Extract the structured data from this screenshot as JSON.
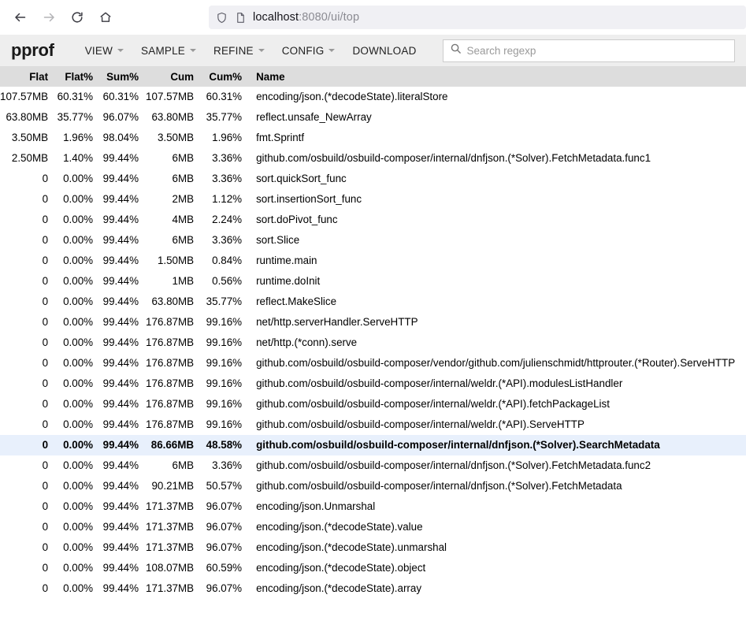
{
  "browser": {
    "back_label": "Back",
    "forward_label": "Forward",
    "reload_label": "Reload",
    "home_label": "Home",
    "url_host": "localhost",
    "url_path": ":8080/ui/top",
    "shield_icon": "shield-icon",
    "page_icon": "page-icon"
  },
  "app": {
    "logo": "pprof",
    "menu": [
      {
        "label": "VIEW",
        "has_caret": true
      },
      {
        "label": "SAMPLE",
        "has_caret": true
      },
      {
        "label": "REFINE",
        "has_caret": true
      },
      {
        "label": "CONFIG",
        "has_caret": true
      },
      {
        "label": "DOWNLOAD",
        "has_caret": false
      }
    ],
    "search": {
      "placeholder": "Search regexp",
      "value": "",
      "icon": "search-icon"
    }
  },
  "table": {
    "columns": [
      "Flat",
      "Flat%",
      "Sum%",
      "Cum",
      "Cum%",
      "Name"
    ],
    "rows": [
      {
        "flat": "107.57MB",
        "flatp": "60.31%",
        "sump": "60.31%",
        "cum": "107.57MB",
        "cump": "60.31%",
        "name": "encoding/json.(*decodeState).literalStore",
        "highlight": false
      },
      {
        "flat": "63.80MB",
        "flatp": "35.77%",
        "sump": "96.07%",
        "cum": "63.80MB",
        "cump": "35.77%",
        "name": "reflect.unsafe_NewArray",
        "highlight": false
      },
      {
        "flat": "3.50MB",
        "flatp": "1.96%",
        "sump": "98.04%",
        "cum": "3.50MB",
        "cump": "1.96%",
        "name": "fmt.Sprintf",
        "highlight": false
      },
      {
        "flat": "2.50MB",
        "flatp": "1.40%",
        "sump": "99.44%",
        "cum": "6MB",
        "cump": "3.36%",
        "name": "github.com/osbuild/osbuild-composer/internal/dnfjson.(*Solver).FetchMetadata.func1",
        "highlight": false
      },
      {
        "flat": "0",
        "flatp": "0.00%",
        "sump": "99.44%",
        "cum": "6MB",
        "cump": "3.36%",
        "name": "sort.quickSort_func",
        "highlight": false
      },
      {
        "flat": "0",
        "flatp": "0.00%",
        "sump": "99.44%",
        "cum": "2MB",
        "cump": "1.12%",
        "name": "sort.insertionSort_func",
        "highlight": false
      },
      {
        "flat": "0",
        "flatp": "0.00%",
        "sump": "99.44%",
        "cum": "4MB",
        "cump": "2.24%",
        "name": "sort.doPivot_func",
        "highlight": false
      },
      {
        "flat": "0",
        "flatp": "0.00%",
        "sump": "99.44%",
        "cum": "6MB",
        "cump": "3.36%",
        "name": "sort.Slice",
        "highlight": false
      },
      {
        "flat": "0",
        "flatp": "0.00%",
        "sump": "99.44%",
        "cum": "1.50MB",
        "cump": "0.84%",
        "name": "runtime.main",
        "highlight": false
      },
      {
        "flat": "0",
        "flatp": "0.00%",
        "sump": "99.44%",
        "cum": "1MB",
        "cump": "0.56%",
        "name": "runtime.doInit",
        "highlight": false
      },
      {
        "flat": "0",
        "flatp": "0.00%",
        "sump": "99.44%",
        "cum": "63.80MB",
        "cump": "35.77%",
        "name": "reflect.MakeSlice",
        "highlight": false
      },
      {
        "flat": "0",
        "flatp": "0.00%",
        "sump": "99.44%",
        "cum": "176.87MB",
        "cump": "99.16%",
        "name": "net/http.serverHandler.ServeHTTP",
        "highlight": false
      },
      {
        "flat": "0",
        "flatp": "0.00%",
        "sump": "99.44%",
        "cum": "176.87MB",
        "cump": "99.16%",
        "name": "net/http.(*conn).serve",
        "highlight": false
      },
      {
        "flat": "0",
        "flatp": "0.00%",
        "sump": "99.44%",
        "cum": "176.87MB",
        "cump": "99.16%",
        "name": "github.com/osbuild/osbuild-composer/vendor/github.com/julienschmidt/httprouter.(*Router).ServeHTTP",
        "highlight": false
      },
      {
        "flat": "0",
        "flatp": "0.00%",
        "sump": "99.44%",
        "cum": "176.87MB",
        "cump": "99.16%",
        "name": "github.com/osbuild/osbuild-composer/internal/weldr.(*API).modulesListHandler",
        "highlight": false
      },
      {
        "flat": "0",
        "flatp": "0.00%",
        "sump": "99.44%",
        "cum": "176.87MB",
        "cump": "99.16%",
        "name": "github.com/osbuild/osbuild-composer/internal/weldr.(*API).fetchPackageList",
        "highlight": false
      },
      {
        "flat": "0",
        "flatp": "0.00%",
        "sump": "99.44%",
        "cum": "176.87MB",
        "cump": "99.16%",
        "name": "github.com/osbuild/osbuild-composer/internal/weldr.(*API).ServeHTTP",
        "highlight": false
      },
      {
        "flat": "0",
        "flatp": "0.00%",
        "sump": "99.44%",
        "cum": "86.66MB",
        "cump": "48.58%",
        "name": "github.com/osbuild/osbuild-composer/internal/dnfjson.(*Solver).SearchMetadata",
        "highlight": true
      },
      {
        "flat": "0",
        "flatp": "0.00%",
        "sump": "99.44%",
        "cum": "6MB",
        "cump": "3.36%",
        "name": "github.com/osbuild/osbuild-composer/internal/dnfjson.(*Solver).FetchMetadata.func2",
        "highlight": false
      },
      {
        "flat": "0",
        "flatp": "0.00%",
        "sump": "99.44%",
        "cum": "90.21MB",
        "cump": "50.57%",
        "name": "github.com/osbuild/osbuild-composer/internal/dnfjson.(*Solver).FetchMetadata",
        "highlight": false
      },
      {
        "flat": "0",
        "flatp": "0.00%",
        "sump": "99.44%",
        "cum": "171.37MB",
        "cump": "96.07%",
        "name": "encoding/json.Unmarshal",
        "highlight": false
      },
      {
        "flat": "0",
        "flatp": "0.00%",
        "sump": "99.44%",
        "cum": "171.37MB",
        "cump": "96.07%",
        "name": "encoding/json.(*decodeState).value",
        "highlight": false
      },
      {
        "flat": "0",
        "flatp": "0.00%",
        "sump": "99.44%",
        "cum": "171.37MB",
        "cump": "96.07%",
        "name": "encoding/json.(*decodeState).unmarshal",
        "highlight": false
      },
      {
        "flat": "0",
        "flatp": "0.00%",
        "sump": "99.44%",
        "cum": "108.07MB",
        "cump": "60.59%",
        "name": "encoding/json.(*decodeState).object",
        "highlight": false
      },
      {
        "flat": "0",
        "flatp": "0.00%",
        "sump": "99.44%",
        "cum": "171.37MB",
        "cump": "96.07%",
        "name": "encoding/json.(*decodeState).array",
        "highlight": false
      }
    ]
  }
}
